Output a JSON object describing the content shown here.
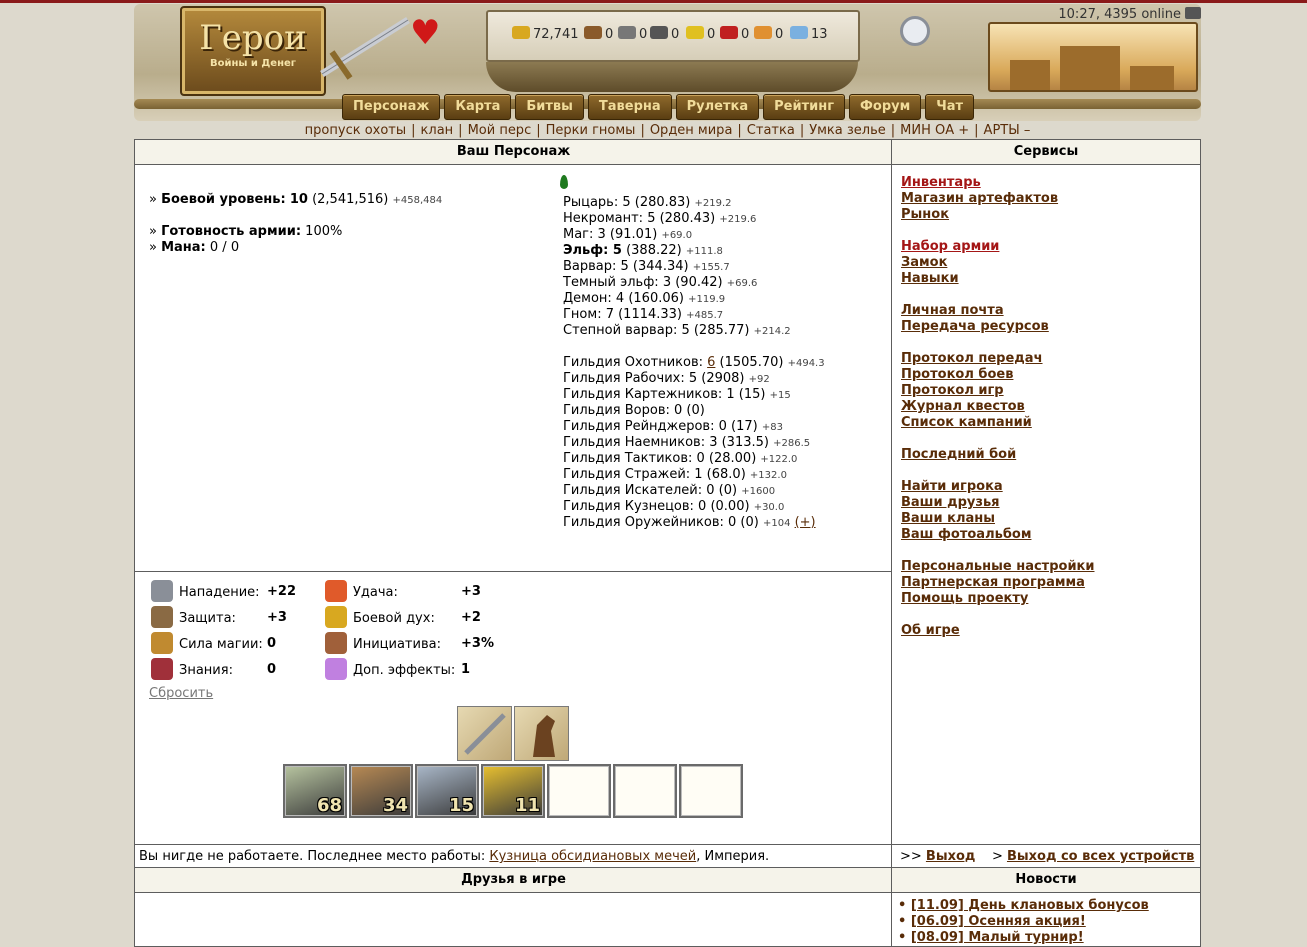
{
  "header": {
    "logo_title": "Герои",
    "logo_subtitle": "Войны и Денег",
    "clock": "10:27, 4395 online",
    "resources": [
      {
        "icon": "gold-icon",
        "value": "72,741",
        "color": "#d8a820"
      },
      {
        "icon": "wood-icon",
        "value": "0",
        "color": "#8a5a2a"
      },
      {
        "icon": "ore-icon",
        "value": "0",
        "color": "#777777"
      },
      {
        "icon": "mercury-icon",
        "value": "0",
        "color": "#555555"
      },
      {
        "icon": "sulfur-icon",
        "value": "0",
        "color": "#e0c020"
      },
      {
        "icon": "crystal-icon",
        "value": "0",
        "color": "#c02020"
      },
      {
        "icon": "gems-icon",
        "value": "0",
        "color": "#e09030"
      },
      {
        "icon": "diamond-icon",
        "value": "13",
        "color": "#7ab0e0"
      }
    ],
    "nav": [
      "Персонаж",
      "Карта",
      "Битвы",
      "Таверна",
      "Рулетка",
      "Рейтинг",
      "Форум",
      "Чат"
    ]
  },
  "submenu": [
    "пропуск охоты",
    "клан",
    "Мой перс",
    "Перки гномы",
    "Орден мира",
    "Статка",
    "Умка зелье",
    "МИН ОА +",
    "АРТЫ –"
  ],
  "character": {
    "panel_title": "Ваш Персонаж",
    "combat_label": "Боевой уровень:",
    "combat_level": "10",
    "combat_exp": "(2,541,516)",
    "combat_delta": "+458,484",
    "army_label": "Готовность армии:",
    "army_value": "100%",
    "mana_label": "Мана:",
    "mana_value": "0 / 0",
    "classes": [
      {
        "text": "Рыцарь: 5 (280.83)",
        "delta": "+219.2",
        "bold": false
      },
      {
        "text": "Некромант: 5 (280.43)",
        "delta": "+219.6",
        "bold": false
      },
      {
        "text": "Маг: 3 (91.01)",
        "delta": "+69.0",
        "bold": false
      },
      {
        "text": "Эльф: 5",
        "extra": "(388.22)",
        "delta": "+111.8",
        "bold": true
      },
      {
        "text": "Варвар: 5 (344.34)",
        "delta": "+155.7",
        "bold": false
      },
      {
        "text": "Темный эльф: 3 (90.42)",
        "delta": "+69.6",
        "bold": false
      },
      {
        "text": "Демон: 4 (160.06)",
        "delta": "+119.9",
        "bold": false
      },
      {
        "text": "Гном: 7 (1114.33)",
        "delta": "+485.7",
        "bold": false
      },
      {
        "text": "Степной варвар: 5 (285.77)",
        "delta": "+214.2",
        "bold": false
      }
    ],
    "guilds": [
      {
        "pre": "Гильдия Охотников: ",
        "link": "6",
        "post": " (1505.70)",
        "delta": "+494.3"
      },
      {
        "pre": "Гильдия Рабочих: 5 (2908)",
        "delta": "+92"
      },
      {
        "pre": "Гильдия Картежников: 1 (15)",
        "delta": "+15"
      },
      {
        "pre": "Гильдия Воров: 0 (0)",
        "delta": ""
      },
      {
        "pre": "Гильдия Рейнджеров: 0 (17)",
        "delta": "+83"
      },
      {
        "pre": "Гильдия Наемников: 3 (313.5)",
        "delta": "+286.5"
      },
      {
        "pre": "Гильдия Тактиков: 0 (28.00)",
        "delta": "+122.0"
      },
      {
        "pre": "Гильдия Стражей: 1 (68.0)",
        "delta": "+132.0"
      },
      {
        "pre": "Гильдия Искателей: 0 (0)",
        "delta": "+1600"
      },
      {
        "pre": "Гильдия Кузнецов: 0 (0.00)",
        "delta": "+30.0"
      },
      {
        "pre": "Гильдия Оружейников: 0 (0)",
        "delta": "+104",
        "plus": "(+)"
      }
    ],
    "attributes_left": [
      {
        "icon": "attack-icon",
        "label": "Нападение:",
        "value": "+22",
        "color": "#8a8f98"
      },
      {
        "icon": "defense-icon",
        "label": "Защита:",
        "value": "+3",
        "color": "#8a6a44"
      },
      {
        "icon": "magic-power-icon",
        "label": "Сила магии:",
        "value": "0",
        "color": "#c08a30"
      },
      {
        "icon": "knowledge-icon",
        "label": "Знания:",
        "value": "0",
        "color": "#a0303a"
      }
    ],
    "attributes_right": [
      {
        "icon": "luck-icon",
        "label": "Удача:",
        "value": "+3",
        "color": "#e05a2a"
      },
      {
        "icon": "morale-icon",
        "label": "Боевой дух:",
        "value": "+2",
        "color": "#d8a820"
      },
      {
        "icon": "initiative-icon",
        "label": "Инициатива:",
        "value": "+3%",
        "color": "#a0603a"
      },
      {
        "icon": "effects-icon",
        "label": "Доп. эффекты:",
        "value": "1",
        "color": "#c080e0"
      }
    ],
    "reset_label": "Сбросить",
    "army": [
      {
        "count": "68",
        "color": "#b7c4a0"
      },
      {
        "count": "34",
        "color": "#b88a54"
      },
      {
        "count": "15",
        "color": "#a9b7c8"
      },
      {
        "count": "11",
        "color": "#e8c030"
      },
      {
        "count": "",
        "color": ""
      },
      {
        "count": "",
        "color": ""
      },
      {
        "count": "",
        "color": ""
      }
    ],
    "work_pre": "Вы нигде не работаете. Последнее место работы: ",
    "work_link": "Кузница обсидиановых мечей",
    "work_post": ", Империя."
  },
  "services": {
    "panel_title": "Сервисы",
    "groups": [
      [
        {
          "label": "Инвентарь",
          "red": true
        },
        {
          "label": "Магазин артефактов"
        },
        {
          "label": "Рынок"
        }
      ],
      [
        {
          "label": "Набор армии",
          "red": true
        },
        {
          "label": "Замок"
        },
        {
          "label": "Навыки"
        }
      ],
      [
        {
          "label": "Личная почта"
        },
        {
          "label": "Передача ресурсов"
        }
      ],
      [
        {
          "label": "Протокол передач"
        },
        {
          "label": "Протокол боев"
        },
        {
          "label": "Протокол игр"
        },
        {
          "label": "Журнал квестов"
        },
        {
          "label": "Список кампаний"
        }
      ],
      [
        {
          "label": "Последний бой"
        }
      ],
      [
        {
          "label": "Найти игрока"
        },
        {
          "label": "Ваши друзья"
        },
        {
          "label": "Ваши кланы"
        },
        {
          "label": "Ваш фотоальбом"
        }
      ],
      [
        {
          "label": "Персональные настройки"
        },
        {
          "label": "Партнерская программа"
        },
        {
          "label": "Помощь проекту"
        }
      ],
      [
        {
          "label": "Об игре"
        }
      ]
    ],
    "logout_prefix": ">> ",
    "logout": "Выход",
    "logout_all_prefix": "> ",
    "logout_all": "Выход со всех устройств"
  },
  "friends": {
    "panel_title": "Друзья в игре"
  },
  "news": {
    "panel_title": "Новости",
    "items": [
      "[11.09] День клановых бонусов",
      "[06.09] Осенняя акция!",
      "[08.09] Малый турнир!"
    ]
  }
}
